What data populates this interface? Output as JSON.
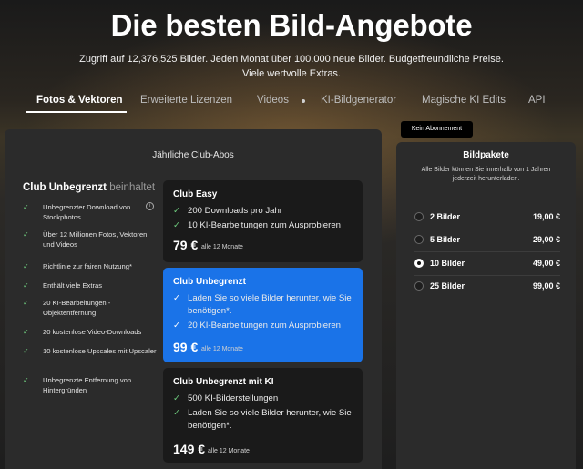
{
  "hero": {
    "title": "Die besten Bild-Angebote",
    "subtitle": "Zugriff auf 12,376,525 Bilder. Jeden Monat über 100.000 neue Bilder. Budgetfreundliche Preise. Viele wertvolle Extras."
  },
  "tabs": [
    {
      "label": "Fotos & Vektoren",
      "active": true
    },
    {
      "label": "Erweiterte Lizenzen"
    },
    {
      "label": "Videos"
    },
    {
      "label": "KI-Bildgenerator"
    },
    {
      "label": "Magische KI Edits"
    },
    {
      "label": "API"
    }
  ],
  "club": {
    "header": "Jährliche Club-Abos",
    "heading_bold": "Club Unbegrenzt",
    "heading_muted": "beinhaltet",
    "features": [
      "Unbegrenzter Download von Stockphotos",
      "Über 12 Millionen Fotos, Vektoren und Videos",
      "Richtlinie zur fairen Nutzung*",
      "Enthält viele Extras",
      "20 KI-Bearbeitungen - Objektentfernung",
      "20 kostenlose Video-Downloads",
      "10 kostenlose Upscales mit Upscaler",
      "Unbegrenzte Entfernung von Hintergründen"
    ],
    "info_glyph": "i"
  },
  "plans": [
    {
      "title": "Club Easy",
      "items": [
        "200 Downloads pro Jahr",
        "10 KI-Bearbeitungen zum Ausprobieren"
      ],
      "price": "79 €",
      "price_note": "alle 12 Monate"
    },
    {
      "title": "Club Unbegrenzt",
      "items": [
        "Laden Sie so viele Bilder herunter, wie Sie benötigen*.",
        "20 KI-Bearbeitungen zum Ausprobieren"
      ],
      "price": "99 €",
      "price_note": "alle 12 Monate"
    },
    {
      "title": "Club Unbegrenzt mit KI",
      "items": [
        "500 KI-Bilderstellungen",
        "Laden Sie so viele Bilder herunter, wie Sie benötigen*."
      ],
      "price": "149 €",
      "price_note": "alle 12 Monate"
    }
  ],
  "packs": {
    "badge": "Kein Abonnement",
    "title": "Bildpakete",
    "subtitle": "Alle Bilder können Sie innerhalb von 1 Jahren jederzeit herunterladen.",
    "options": [
      {
        "label": "2 Bilder",
        "price": "19,00 €",
        "selected": false
      },
      {
        "label": "5 Bilder",
        "price": "29,00 €",
        "selected": false
      },
      {
        "label": "10 Bilder",
        "price": "49,00 €",
        "selected": true
      },
      {
        "label": "25 Bilder",
        "price": "99,00 €",
        "selected": false
      }
    ]
  },
  "glyphs": {
    "check": "✓"
  }
}
